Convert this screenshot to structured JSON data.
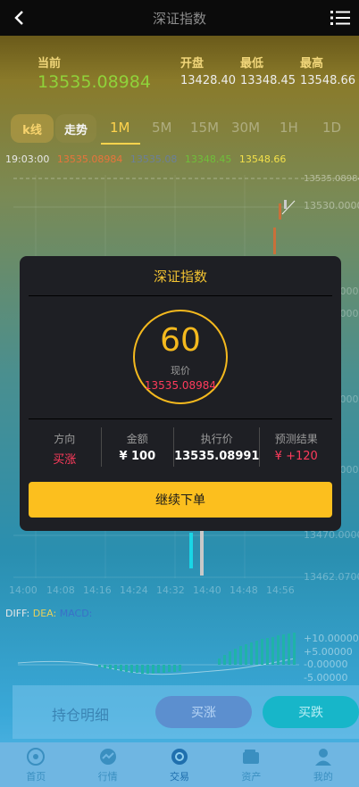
{
  "header": {
    "title": "深证指数"
  },
  "quote": {
    "current_label": "当前",
    "current_value": "13535.08984",
    "open_label": "开盘",
    "open_value": "13428.40",
    "low_label": "最低",
    "low_value": "13348.45",
    "high_label": "最高",
    "high_value": "13548.66"
  },
  "chart_tabs": {
    "kline": "k线",
    "trend": "走势"
  },
  "periods": [
    "1M",
    "5M",
    "15M",
    "30M",
    "1H",
    "1D"
  ],
  "ohlc_line": {
    "time": "19:03:00",
    "open": "13535.08984",
    "close": "13535.08",
    "low": "13348.45",
    "high": "13548.66"
  },
  "y_axis": [
    "13535.08984",
    "13530.0000",
    "3.0000",
    "0.0000",
    "3.0000",
    "0.0000",
    "13470.0000",
    "13462.0700"
  ],
  "x_axis": [
    "14:00",
    "14:08",
    "14:16",
    "14:24",
    "14:32",
    "14:40",
    "14:48",
    "14:56"
  ],
  "macd": {
    "diff": "DIFF:",
    "dea": "DEA:",
    "macd": "MACD:",
    "axis": [
      "+10.00000",
      "+5.00000",
      "-0.00000",
      "-5.00000"
    ]
  },
  "modal": {
    "title": "深证指数",
    "countdown": "60",
    "price_caption": "现价",
    "price": "13535.08984",
    "direction_label": "方向",
    "direction_value": "买涨",
    "amount_label": "金额",
    "amount_value": "¥ 100",
    "strike_label": "执行价",
    "strike_value": "13535.08991",
    "result_label": "预测结果",
    "result_value": "¥ +120",
    "continue_button": "继续下单"
  },
  "actions": {
    "holdings": "持仓明细",
    "buy_up": "买涨",
    "buy_down": "买跌"
  },
  "tabbar": [
    {
      "label": "首页",
      "icon": "home-icon"
    },
    {
      "label": "行情",
      "icon": "market-icon"
    },
    {
      "label": "交易",
      "icon": "trade-icon"
    },
    {
      "label": "资产",
      "icon": "wallet-icon"
    },
    {
      "label": "我的",
      "icon": "user-icon"
    }
  ],
  "colors": {
    "accent": "#fcbf1e",
    "up_red": "#ff3b5c",
    "green": "#8fd23a",
    "cyan": "#17b6c9"
  }
}
